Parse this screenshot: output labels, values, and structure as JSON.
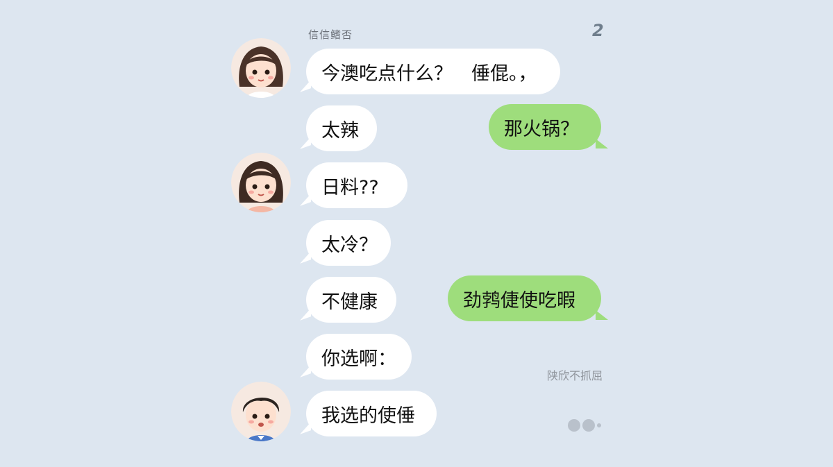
{
  "header": {
    "label": "信信鳍否",
    "corner_mark": "2"
  },
  "messages": [
    {
      "side": "left",
      "text": "今澳吃点什么？　倕倱。，"
    },
    {
      "side": "left",
      "text": "太辣"
    },
    {
      "side": "right",
      "text": "那火锅？"
    },
    {
      "side": "left",
      "text": "日料??"
    },
    {
      "side": "left",
      "text": "太冷？"
    },
    {
      "side": "left",
      "text": "不健康"
    },
    {
      "side": "right",
      "text": "劲鹁倢使吃暇"
    },
    {
      "side": "left",
      "text": "你选啊："
    },
    {
      "side": "left",
      "text": "我选的使倕"
    }
  ],
  "side_note": "陕欣不抓屈",
  "colors": {
    "background": "#dde6f0",
    "left_bubble": "#ffffff",
    "right_bubble": "#9edd7c"
  },
  "icons": {
    "avatar_1": "girl-avatar-icon",
    "avatar_2": "girl-avatar-icon",
    "avatar_3": "boy-avatar-icon",
    "typing": "typing-dots-icon"
  }
}
